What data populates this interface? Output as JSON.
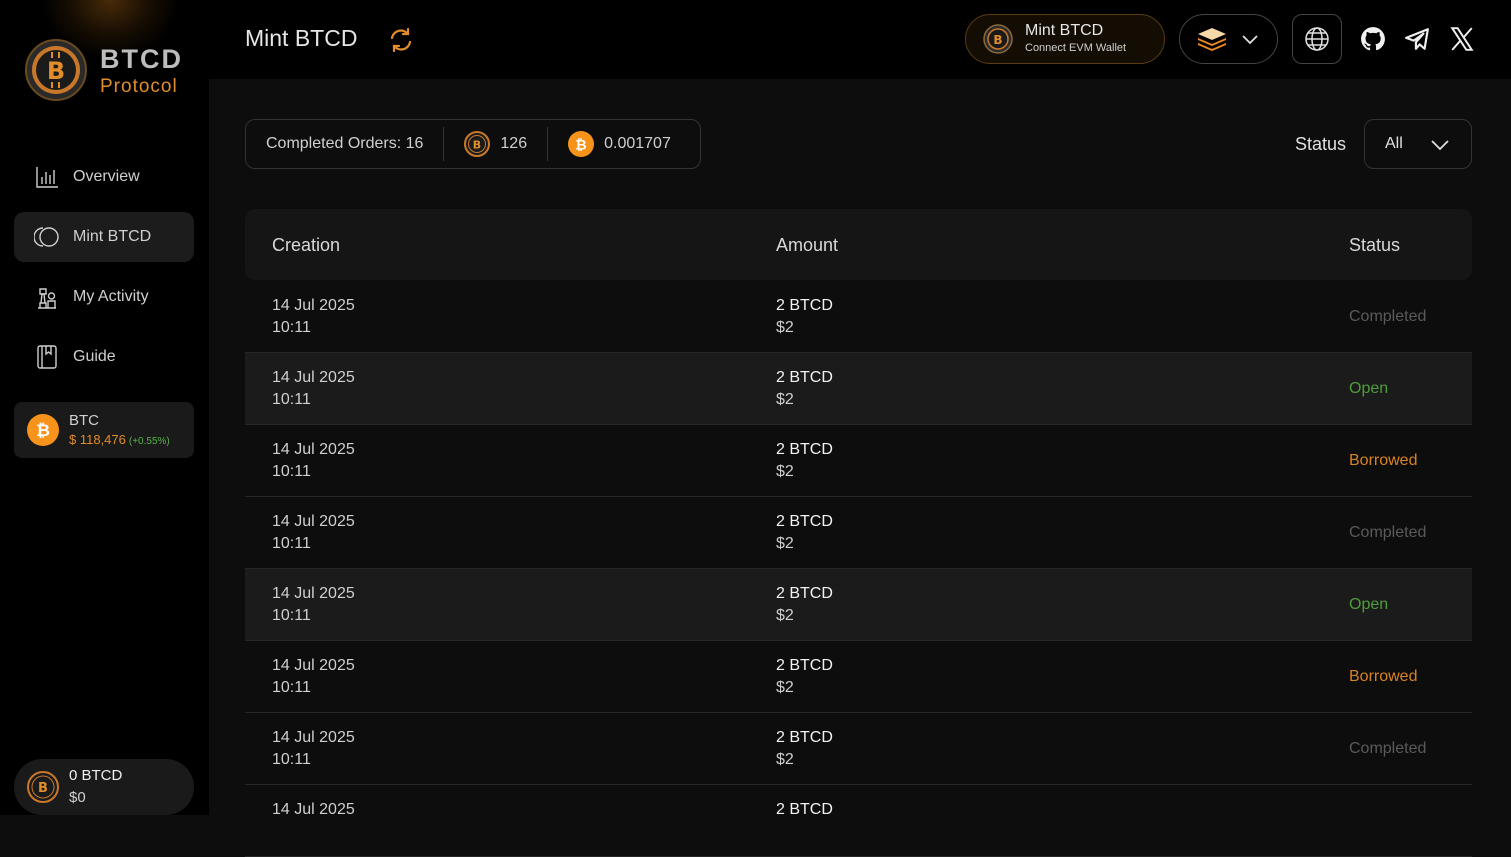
{
  "brand": {
    "name": "BTCD",
    "subtitle": "Protocol"
  },
  "sidebar": {
    "items": [
      {
        "label": "Overview",
        "icon": "chart-bars-icon"
      },
      {
        "label": "Mint BTCD",
        "icon": "mint-rings-icon",
        "active": true
      },
      {
        "label": "My Activity",
        "icon": "activity-chess-icon"
      },
      {
        "label": "Guide",
        "icon": "book-icon"
      }
    ],
    "btc_ticker": {
      "name": "BTC",
      "price": "$ 118,476",
      "change": "(+0.55%)"
    },
    "wallet": {
      "amount": "0 BTCD",
      "usd": "$0"
    }
  },
  "header": {
    "title": "Mint BTCD",
    "wallet_button": {
      "title": "Mint BTCD",
      "subtitle": "Connect EVM Wallet"
    }
  },
  "stats": {
    "completed_orders": "Completed Orders: 16",
    "btcd_total": "126",
    "btc_total": "0.001707"
  },
  "filter": {
    "label": "Status",
    "selected": "All"
  },
  "table": {
    "headers": {
      "creation": "Creation",
      "amount": "Amount",
      "status": "Status"
    },
    "rows": [
      {
        "date": "14 Jul 2025",
        "time": "10:11",
        "amount": "2 BTCD",
        "usd": "$2",
        "status": "Completed"
      },
      {
        "date": "14 Jul 2025",
        "time": "10:11",
        "amount": "2 BTCD",
        "usd": "$2",
        "status": "Open"
      },
      {
        "date": "14 Jul 2025",
        "time": "10:11",
        "amount": "2 BTCD",
        "usd": "$2",
        "status": "Borrowed"
      },
      {
        "date": "14 Jul 2025",
        "time": "10:11",
        "amount": "2 BTCD",
        "usd": "$2",
        "status": "Completed"
      },
      {
        "date": "14 Jul 2025",
        "time": "10:11",
        "amount": "2 BTCD",
        "usd": "$2",
        "status": "Open"
      },
      {
        "date": "14 Jul 2025",
        "time": "10:11",
        "amount": "2 BTCD",
        "usd": "$2",
        "status": "Borrowed"
      },
      {
        "date": "14 Jul 2025",
        "time": "10:11",
        "amount": "2 BTCD",
        "usd": "$2",
        "status": "Completed"
      },
      {
        "date": "14 Jul 2025",
        "time": "",
        "amount": "2 BTCD",
        "usd": "",
        "status": ""
      }
    ]
  },
  "colors": {
    "accent": "#e08d2a",
    "open": "#4f9c3a",
    "borrowed": "#d88322",
    "completed": "#5a5a5a",
    "background": "#0d0d0d"
  }
}
